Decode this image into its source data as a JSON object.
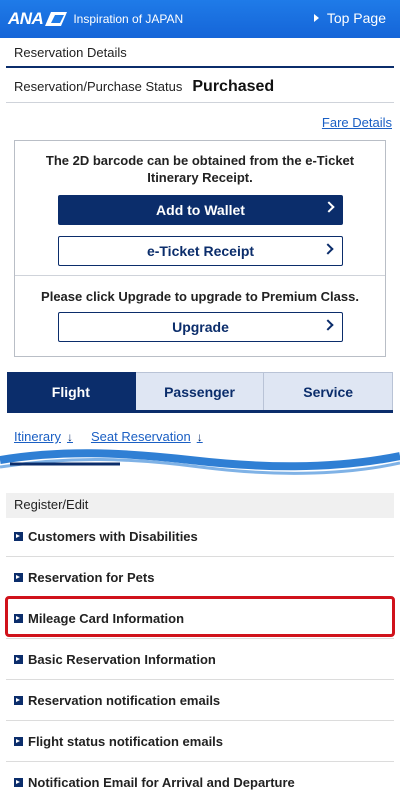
{
  "header": {
    "logo_text": "ANA",
    "tagline": "Inspiration of JAPAN",
    "top_page_label": "Top Page"
  },
  "section": {
    "title": "Reservation Details"
  },
  "status": {
    "label": "Reservation/Purchase Status",
    "value": "Purchased"
  },
  "fare_details_label": "Fare Details",
  "ticket_box": {
    "note_line1": "The 2D barcode can be obtained from the e-Ticket",
    "note_line2": "Itinerary Receipt.",
    "wallet_label": "Add to Wallet",
    "receipt_label": "e-Ticket Receipt",
    "upgrade_note": "Please click Upgrade to upgrade to Premium Class.",
    "upgrade_label": "Upgrade"
  },
  "tabs": [
    {
      "label": "Flight",
      "active": true
    },
    {
      "label": "Passenger",
      "active": false
    },
    {
      "label": "Service",
      "active": false
    }
  ],
  "sublinks": [
    {
      "label": "Itinerary"
    },
    {
      "label": "Seat Reservation"
    }
  ],
  "register": {
    "header": "Register/Edit",
    "items": [
      {
        "label": "Customers with Disabilities"
      },
      {
        "label": "Reservation for Pets"
      },
      {
        "label": "Mileage Card Information",
        "highlighted": true
      },
      {
        "label": "Basic Reservation Information"
      },
      {
        "label": "Reservation notification emails"
      },
      {
        "label": "Flight status notification emails"
      },
      {
        "label": "Notification Email for Arrival and Departure"
      }
    ]
  },
  "colors": {
    "brand_blue": "#1f7be8",
    "navy": "#0b2d6b",
    "link": "#1a5fc4",
    "highlight_red": "#d0121b"
  }
}
